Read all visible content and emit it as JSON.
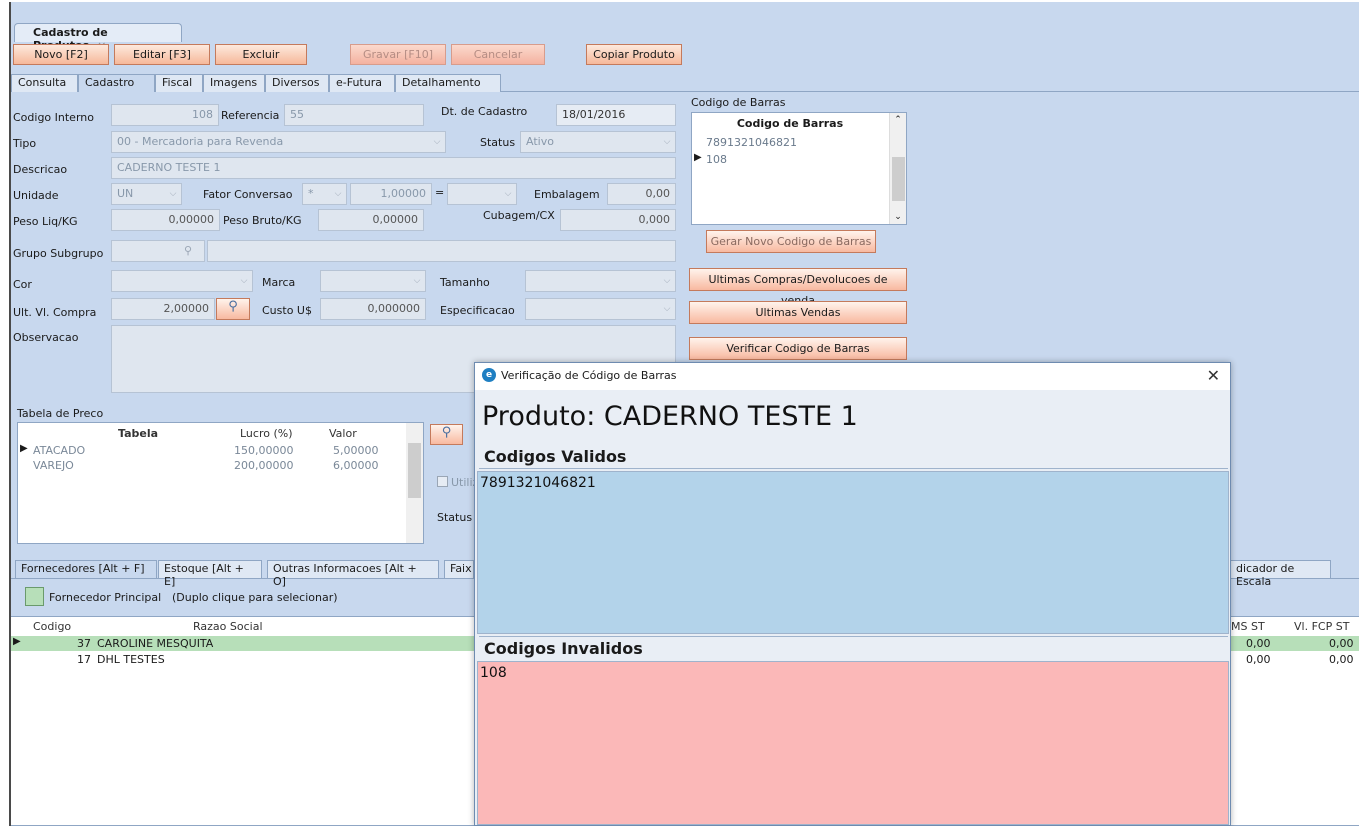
{
  "doc_tab": {
    "label": "Cadastro de Produtos",
    "close": "×"
  },
  "toolbar": {
    "novo": "Novo [F2]",
    "editar": "Editar [F3]",
    "excluir": "Excluir",
    "gravar": "Gravar [F10]",
    "cancelar": "Cancelar",
    "copiar": "Copiar Produto"
  },
  "tabs": [
    "Consulta",
    "Cadastro",
    "Fiscal",
    "Imagens",
    "Diversos",
    "e-Futura",
    "Detalhamento"
  ],
  "form": {
    "codigo_interno_label": "Codigo Interno",
    "codigo_interno": "108",
    "referencia_label": "Referencia",
    "referencia": "55",
    "dt_cadastro_label": "Dt. de Cadastro",
    "dt_cadastro": "18/01/2016",
    "tipo_label": "Tipo",
    "tipo": "00 - Mercadoria para Revenda",
    "status_label": "Status",
    "status": "Ativo",
    "descricao_label": "Descricao",
    "descricao": "CADERNO TESTE 1",
    "unidade_label": "Unidade",
    "unidade": "UN",
    "fator_label": "Fator Conversao",
    "fator_op": "*",
    "fator": "1,00000",
    "eq": "=",
    "embalagem_label": "Embalagem",
    "embalagem": "0,00",
    "peso_liq_label": "Peso Liq/KG",
    "peso_liq": "0,00000",
    "peso_bruto_label": "Peso Bruto/KG",
    "peso_bruto": "0,00000",
    "cubagem_label": "Cubagem/CX",
    "cubagem": "0,000",
    "grupo_label": "Grupo Subgrupo",
    "cor_label": "Cor",
    "marca_label": "Marca",
    "tamanho_label": "Tamanho",
    "ult_compra_label": "Ult. Vl. Compra",
    "ult_compra": "2,00000",
    "custo_label": "Custo U$",
    "custo": "0,000000",
    "espec_label": "Especificacao",
    "obs_label": "Observacao"
  },
  "barcodes": {
    "title": "Codigo de Barras",
    "header": "Codigo de Barras",
    "items": [
      "7891321046821",
      "108"
    ]
  },
  "side_buttons": {
    "gerar": "Gerar Novo Codigo de Barras",
    "ultimas_compras": "Ultimas Compras/Devolucoes de venda",
    "ultimas_vendas": "Ultimas Vendas",
    "verificar": "Verificar Codigo de Barras"
  },
  "price_table": {
    "title": "Tabela de Preco",
    "headers": [
      "Tabela",
      "Lucro (%)",
      "Valor"
    ],
    "rows": [
      [
        "ATACADO",
        "150,00000",
        "5,00000"
      ],
      [
        "VAREJO",
        "200,00000",
        "6,00000"
      ]
    ]
  },
  "partial": {
    "utiliza": "Utiliz",
    "status": "Status r"
  },
  "bottom_tabs": [
    "Fornecedores [Alt + F]",
    "Estoque [Alt + E]",
    "Outras Informacoes [Alt + O]",
    "Faix",
    "dicador de Escala"
  ],
  "legend": {
    "principal": "Fornecedor Principal",
    "hint": "(Duplo clique para selecionar)"
  },
  "suppliers": {
    "headers": [
      "Codigo",
      "Razao Social"
    ],
    "right_headers": [
      "MS ST",
      "Vl. FCP ST"
    ],
    "rows": [
      {
        "codigo": "37",
        "nome": "CAROLINE MESQUITA",
        "ms": "0,00",
        "fcp": "0,00"
      },
      {
        "codigo": "17",
        "nome": "DHL TESTES",
        "ms": "0,00",
        "fcp": "0,00"
      }
    ]
  },
  "dialog": {
    "title": "Verificação de Código de Barras",
    "produto": "Produto: CADERNO TESTE 1",
    "validos_label": "Codigos Validos",
    "validos": "7891321046821",
    "invalidos_label": "Codigos Invalidos",
    "invalidos": "108",
    "close": "✕"
  },
  "colors": {
    "valid_bg": "#b3d3ea",
    "invalid_bg": "#fbb8b8",
    "principal_row": "#b7dfb9",
    "button": "#f8b9a0"
  }
}
